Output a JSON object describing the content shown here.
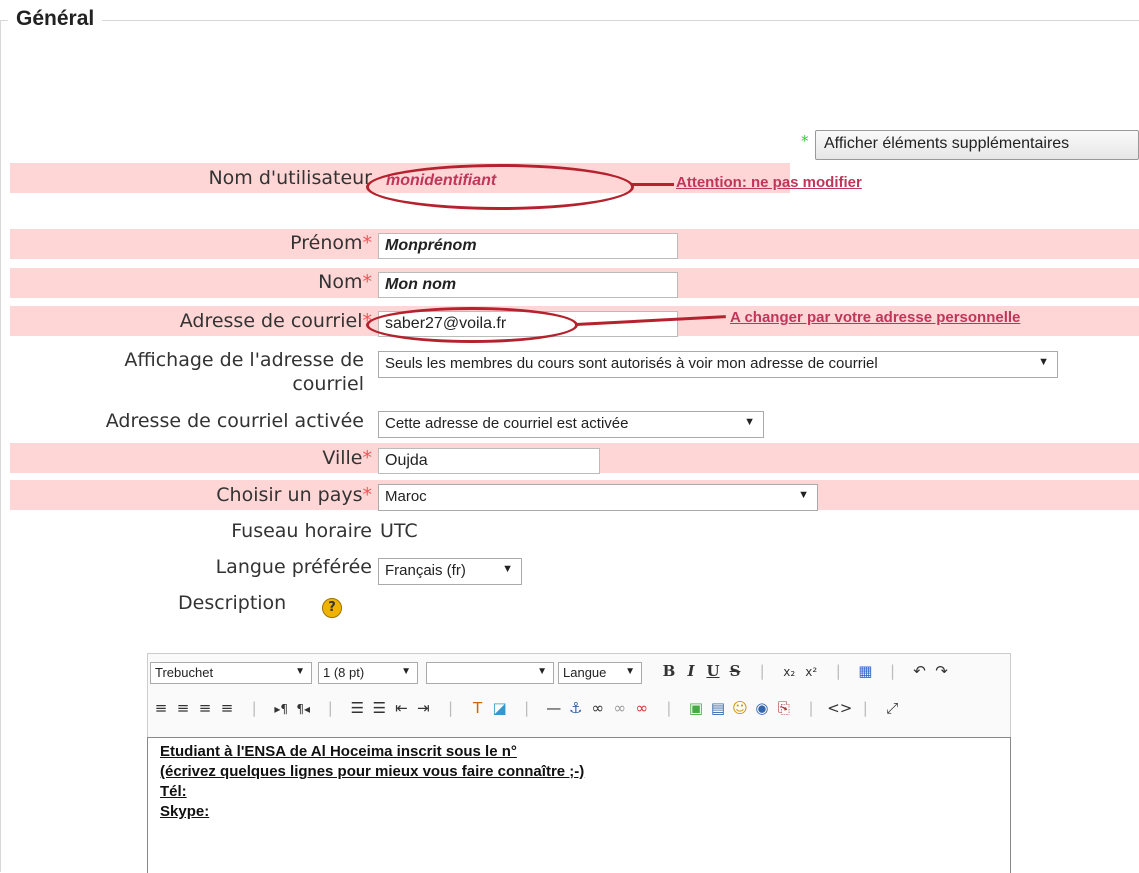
{
  "section": {
    "legend": "Général"
  },
  "show_more_button": {
    "star": "*",
    "label": "Afficher éléments supplémentaires"
  },
  "fields": {
    "username": {
      "label": "Nom d'utilisateur",
      "value": "monidentifiant"
    },
    "firstname": {
      "label": "Prénom",
      "req": "*",
      "value": "Monprénom"
    },
    "lastname": {
      "label": "Nom",
      "req": "*",
      "value": "Mon nom"
    },
    "email": {
      "label": "Adresse de courriel",
      "req": "*",
      "value": "saber27@voila.fr"
    },
    "email_display": {
      "label_line1": "Affichage de l'adresse de",
      "label_line2": "courriel",
      "value": "Seuls les membres du cours sont autorisés à voir mon adresse de courriel"
    },
    "email_active": {
      "label": "Adresse de courriel activée",
      "value": "Cette adresse de courriel est activée"
    },
    "city": {
      "label": "Ville",
      "req": "*",
      "value": "Oujda"
    },
    "country": {
      "label": "Choisir un pays",
      "req": "*",
      "value": "Maroc"
    },
    "timezone": {
      "label": "Fuseau horaire",
      "value": "UTC"
    },
    "language": {
      "label": "Langue préférée",
      "value": "Français (fr)"
    },
    "description": {
      "label": "Description",
      "help": "?"
    }
  },
  "annotations": {
    "username_note": "Attention: ne pas modifier",
    "email_note": "A changer par votre adresse personnelle"
  },
  "editor": {
    "font": "Trebuchet",
    "size": "1 (8 pt)",
    "style": "",
    "lang": "Langue",
    "lines": [
      "Etudiant à l'ENSA de Al Hoceima inscrit sous le n°",
      "(écrivez quelques lignes pour mieux vous faire connaître ;-)",
      "Tél:",
      "Skype:"
    ]
  },
  "colors": {
    "required_band": "#ffd6d6",
    "annotation": "#c0365b",
    "ellipse": "#b5222e"
  }
}
